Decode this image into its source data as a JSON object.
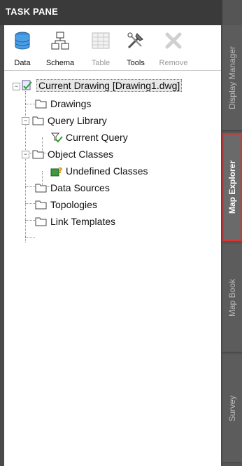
{
  "pane": {
    "title": "TASK PANE"
  },
  "toolbar": {
    "items": [
      {
        "label": "Data",
        "icon": "database-icon",
        "enabled": true
      },
      {
        "label": "Schema",
        "icon": "schema-icon",
        "enabled": true
      },
      {
        "label": "Table",
        "icon": "table-icon",
        "enabled": false
      },
      {
        "label": "Tools",
        "icon": "tools-icon",
        "enabled": true
      },
      {
        "label": "Remove",
        "icon": "remove-icon",
        "enabled": false
      }
    ]
  },
  "tree": {
    "root": "Current Drawing [Drawing1.dwg]",
    "drawings": "Drawings",
    "query_library": "Query Library",
    "current_query": "Current Query",
    "object_classes": "Object Classes",
    "undefined_classes": "Undefined Classes",
    "data_sources": "Data Sources",
    "topologies": "Topologies",
    "link_templates": "Link Templates"
  },
  "side_tabs": [
    {
      "label": "Display Manager",
      "active": false
    },
    {
      "label": "Map Explorer",
      "active": true
    },
    {
      "label": "Map Book",
      "active": false
    },
    {
      "label": "Survey",
      "active": false
    }
  ],
  "colors": {
    "active_tab_border": "#e03030",
    "panel_bg": "#ffffff",
    "chrome": "#4a4a4a"
  }
}
